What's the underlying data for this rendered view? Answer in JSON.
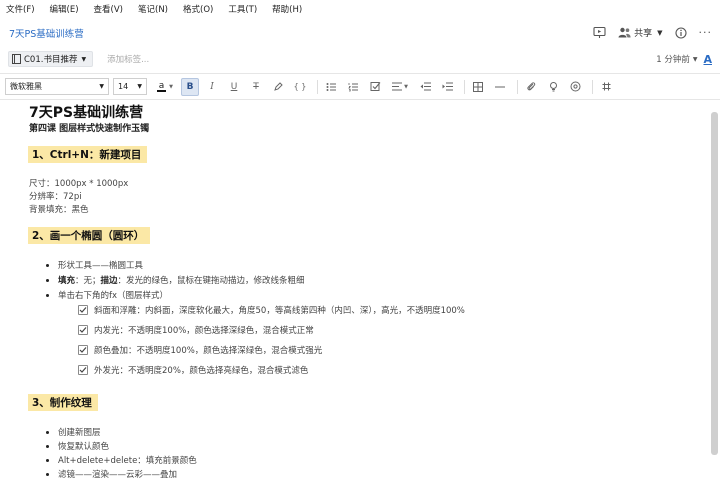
{
  "menu": [
    "文件(F)",
    "编辑(E)",
    "查看(V)",
    "笔记(N)",
    "格式(O)",
    "工具(T)",
    "帮助(H)"
  ],
  "note_title": "7天PS基础训练营",
  "share_label": "共享",
  "notebook_label": "C01.书目推荐",
  "tag_placeholder": "添加标签...",
  "time_label": "1 分钟前",
  "toolbar": {
    "font_family": "微软雅黑",
    "font_size": "14",
    "text_color_glyph": "a",
    "bold": "B",
    "italic": "I",
    "underline": "U",
    "strike": "T",
    "code": "{ }"
  },
  "doc": {
    "title": "7天PS基础训练营",
    "subtitle": "第四课  图层样式快速制作玉镯",
    "s1": {
      "heading": "1、Ctrl+N：新建项目",
      "lines": [
        "尺寸：1000px * 1000px",
        "分辨率：72pi",
        "背景填充：黑色"
      ]
    },
    "s2": {
      "heading": "2、画一个椭圆（圆环）",
      "item1": "形状工具——椭圆工具",
      "item2_a": "填充",
      "item2_b": "：无；",
      "item2_c": "描边",
      "item2_d": "：发光的绿色，鼠标在键拖动描边，修改线条粗细",
      "item3": "单击右下角的fx（图层样式）",
      "checks": [
        "斜面和浮雕：内斜面，深度软化最大，角度50，等高线第四种（内凹、深），高光，不透明度100%",
        "内发光：不透明度100%，颜色选择深绿色，混合模式正常",
        "颜色叠加：不透明度100%，颜色选择深绿色，混合模式强光",
        "外发光：不透明度20%，颜色选择亮绿色，混合模式滤色"
      ]
    },
    "s3": {
      "heading": "3、制作纹理",
      "items": [
        "创建新图层",
        "恢复默认颜色",
        "Alt+delete+delete：填充前景颜色",
        "滤镜——渲染——云彩——叠加"
      ]
    }
  },
  "colors": {
    "highlight": "#fbe8a6",
    "accent": "#2b6cc4"
  }
}
